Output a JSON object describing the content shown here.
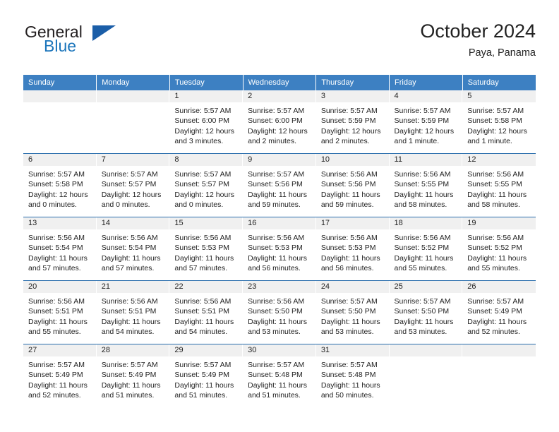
{
  "brand": {
    "name_top": "General",
    "name_bottom": "Blue",
    "accent_color": "#1b75bb",
    "triangle_color": "#1b5ea8"
  },
  "header": {
    "title": "October 2024",
    "subtitle": "Paya, Panama"
  },
  "calendar": {
    "header_bg": "#3d80c2",
    "daynum_band_bg": "#f0f0f0",
    "row_divider_color": "#2a6ead",
    "weekdays": [
      "Sunday",
      "Monday",
      "Tuesday",
      "Wednesday",
      "Thursday",
      "Friday",
      "Saturday"
    ],
    "weeks": [
      [
        {
          "day": "",
          "sunrise": "",
          "sunset": "",
          "daylight": ""
        },
        {
          "day": "",
          "sunrise": "",
          "sunset": "",
          "daylight": ""
        },
        {
          "day": "1",
          "sunrise": "Sunrise: 5:57 AM",
          "sunset": "Sunset: 6:00 PM",
          "daylight": "Daylight: 12 hours and 3 minutes."
        },
        {
          "day": "2",
          "sunrise": "Sunrise: 5:57 AM",
          "sunset": "Sunset: 6:00 PM",
          "daylight": "Daylight: 12 hours and 2 minutes."
        },
        {
          "day": "3",
          "sunrise": "Sunrise: 5:57 AM",
          "sunset": "Sunset: 5:59 PM",
          "daylight": "Daylight: 12 hours and 2 minutes."
        },
        {
          "day": "4",
          "sunrise": "Sunrise: 5:57 AM",
          "sunset": "Sunset: 5:59 PM",
          "daylight": "Daylight: 12 hours and 1 minute."
        },
        {
          "day": "5",
          "sunrise": "Sunrise: 5:57 AM",
          "sunset": "Sunset: 5:58 PM",
          "daylight": "Daylight: 12 hours and 1 minute."
        }
      ],
      [
        {
          "day": "6",
          "sunrise": "Sunrise: 5:57 AM",
          "sunset": "Sunset: 5:58 PM",
          "daylight": "Daylight: 12 hours and 0 minutes."
        },
        {
          "day": "7",
          "sunrise": "Sunrise: 5:57 AM",
          "sunset": "Sunset: 5:57 PM",
          "daylight": "Daylight: 12 hours and 0 minutes."
        },
        {
          "day": "8",
          "sunrise": "Sunrise: 5:57 AM",
          "sunset": "Sunset: 5:57 PM",
          "daylight": "Daylight: 12 hours and 0 minutes."
        },
        {
          "day": "9",
          "sunrise": "Sunrise: 5:57 AM",
          "sunset": "Sunset: 5:56 PM",
          "daylight": "Daylight: 11 hours and 59 minutes."
        },
        {
          "day": "10",
          "sunrise": "Sunrise: 5:56 AM",
          "sunset": "Sunset: 5:56 PM",
          "daylight": "Daylight: 11 hours and 59 minutes."
        },
        {
          "day": "11",
          "sunrise": "Sunrise: 5:56 AM",
          "sunset": "Sunset: 5:55 PM",
          "daylight": "Daylight: 11 hours and 58 minutes."
        },
        {
          "day": "12",
          "sunrise": "Sunrise: 5:56 AM",
          "sunset": "Sunset: 5:55 PM",
          "daylight": "Daylight: 11 hours and 58 minutes."
        }
      ],
      [
        {
          "day": "13",
          "sunrise": "Sunrise: 5:56 AM",
          "sunset": "Sunset: 5:54 PM",
          "daylight": "Daylight: 11 hours and 57 minutes."
        },
        {
          "day": "14",
          "sunrise": "Sunrise: 5:56 AM",
          "sunset": "Sunset: 5:54 PM",
          "daylight": "Daylight: 11 hours and 57 minutes."
        },
        {
          "day": "15",
          "sunrise": "Sunrise: 5:56 AM",
          "sunset": "Sunset: 5:53 PM",
          "daylight": "Daylight: 11 hours and 57 minutes."
        },
        {
          "day": "16",
          "sunrise": "Sunrise: 5:56 AM",
          "sunset": "Sunset: 5:53 PM",
          "daylight": "Daylight: 11 hours and 56 minutes."
        },
        {
          "day": "17",
          "sunrise": "Sunrise: 5:56 AM",
          "sunset": "Sunset: 5:53 PM",
          "daylight": "Daylight: 11 hours and 56 minutes."
        },
        {
          "day": "18",
          "sunrise": "Sunrise: 5:56 AM",
          "sunset": "Sunset: 5:52 PM",
          "daylight": "Daylight: 11 hours and 55 minutes."
        },
        {
          "day": "19",
          "sunrise": "Sunrise: 5:56 AM",
          "sunset": "Sunset: 5:52 PM",
          "daylight": "Daylight: 11 hours and 55 minutes."
        }
      ],
      [
        {
          "day": "20",
          "sunrise": "Sunrise: 5:56 AM",
          "sunset": "Sunset: 5:51 PM",
          "daylight": "Daylight: 11 hours and 55 minutes."
        },
        {
          "day": "21",
          "sunrise": "Sunrise: 5:56 AM",
          "sunset": "Sunset: 5:51 PM",
          "daylight": "Daylight: 11 hours and 54 minutes."
        },
        {
          "day": "22",
          "sunrise": "Sunrise: 5:56 AM",
          "sunset": "Sunset: 5:51 PM",
          "daylight": "Daylight: 11 hours and 54 minutes."
        },
        {
          "day": "23",
          "sunrise": "Sunrise: 5:56 AM",
          "sunset": "Sunset: 5:50 PM",
          "daylight": "Daylight: 11 hours and 53 minutes."
        },
        {
          "day": "24",
          "sunrise": "Sunrise: 5:57 AM",
          "sunset": "Sunset: 5:50 PM",
          "daylight": "Daylight: 11 hours and 53 minutes."
        },
        {
          "day": "25",
          "sunrise": "Sunrise: 5:57 AM",
          "sunset": "Sunset: 5:50 PM",
          "daylight": "Daylight: 11 hours and 53 minutes."
        },
        {
          "day": "26",
          "sunrise": "Sunrise: 5:57 AM",
          "sunset": "Sunset: 5:49 PM",
          "daylight": "Daylight: 11 hours and 52 minutes."
        }
      ],
      [
        {
          "day": "27",
          "sunrise": "Sunrise: 5:57 AM",
          "sunset": "Sunset: 5:49 PM",
          "daylight": "Daylight: 11 hours and 52 minutes."
        },
        {
          "day": "28",
          "sunrise": "Sunrise: 5:57 AM",
          "sunset": "Sunset: 5:49 PM",
          "daylight": "Daylight: 11 hours and 51 minutes."
        },
        {
          "day": "29",
          "sunrise": "Sunrise: 5:57 AM",
          "sunset": "Sunset: 5:49 PM",
          "daylight": "Daylight: 11 hours and 51 minutes."
        },
        {
          "day": "30",
          "sunrise": "Sunrise: 5:57 AM",
          "sunset": "Sunset: 5:48 PM",
          "daylight": "Daylight: 11 hours and 51 minutes."
        },
        {
          "day": "31",
          "sunrise": "Sunrise: 5:57 AM",
          "sunset": "Sunset: 5:48 PM",
          "daylight": "Daylight: 11 hours and 50 minutes."
        },
        {
          "day": "",
          "sunrise": "",
          "sunset": "",
          "daylight": ""
        },
        {
          "day": "",
          "sunrise": "",
          "sunset": "",
          "daylight": ""
        }
      ]
    ]
  }
}
